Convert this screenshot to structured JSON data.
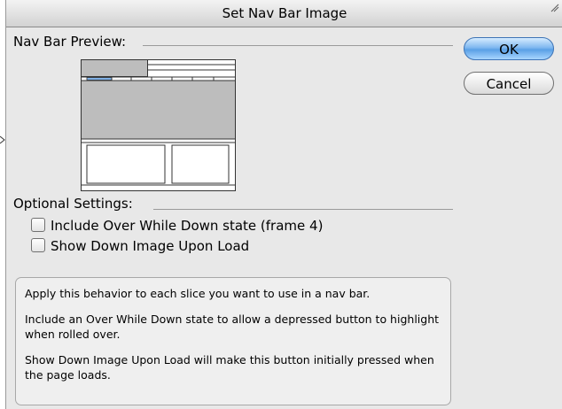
{
  "window": {
    "title": "Set Nav Bar Image"
  },
  "preview": {
    "label": "Nav Bar Preview:"
  },
  "buttons": {
    "ok": "OK",
    "cancel": "Cancel"
  },
  "optional": {
    "label": "Optional Settings:",
    "options": [
      {
        "label": "Include Over While Down state (frame 4)",
        "checked": false
      },
      {
        "label": "Show Down Image Upon Load",
        "checked": false
      }
    ]
  },
  "description": {
    "paragraphs": [
      "Apply this behavior to each slice you want to use in a nav bar.",
      "Include an Over While Down state to allow a depressed button to highlight when rolled over.",
      "Show Down Image Upon Load will make this button initially pressed when the page loads."
    ]
  },
  "colors": {
    "highlight_slice": "#7fb0e6",
    "preview_fill": "#bdbdbd",
    "default_button": "#5aa0e6"
  }
}
